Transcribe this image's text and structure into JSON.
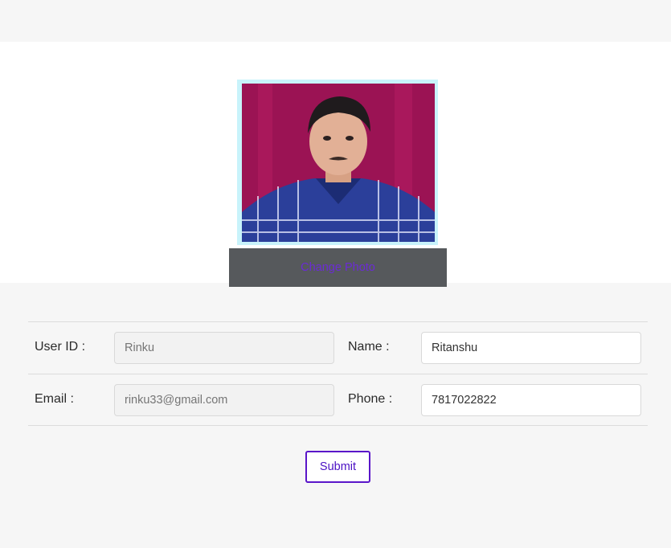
{
  "profile": {
    "photo_alt": "profile photo",
    "change_photo_label": "Change Photo"
  },
  "form": {
    "rows": [
      {
        "left": {
          "label": "User ID :",
          "value": "Rinku",
          "readonly": true
        },
        "right": {
          "label": "Name :",
          "value": "Ritanshu",
          "readonly": false
        }
      },
      {
        "left": {
          "label": "Email :",
          "value": "rinku33@gmail.com",
          "readonly": true
        },
        "right": {
          "label": "Phone :",
          "value": "7817022822",
          "readonly": false
        }
      }
    ],
    "submit_label": "Submit"
  },
  "colors": {
    "accent": "#5a16c9",
    "change_photo_bg": "#56595c",
    "page_bg": "#f6f6f6"
  }
}
